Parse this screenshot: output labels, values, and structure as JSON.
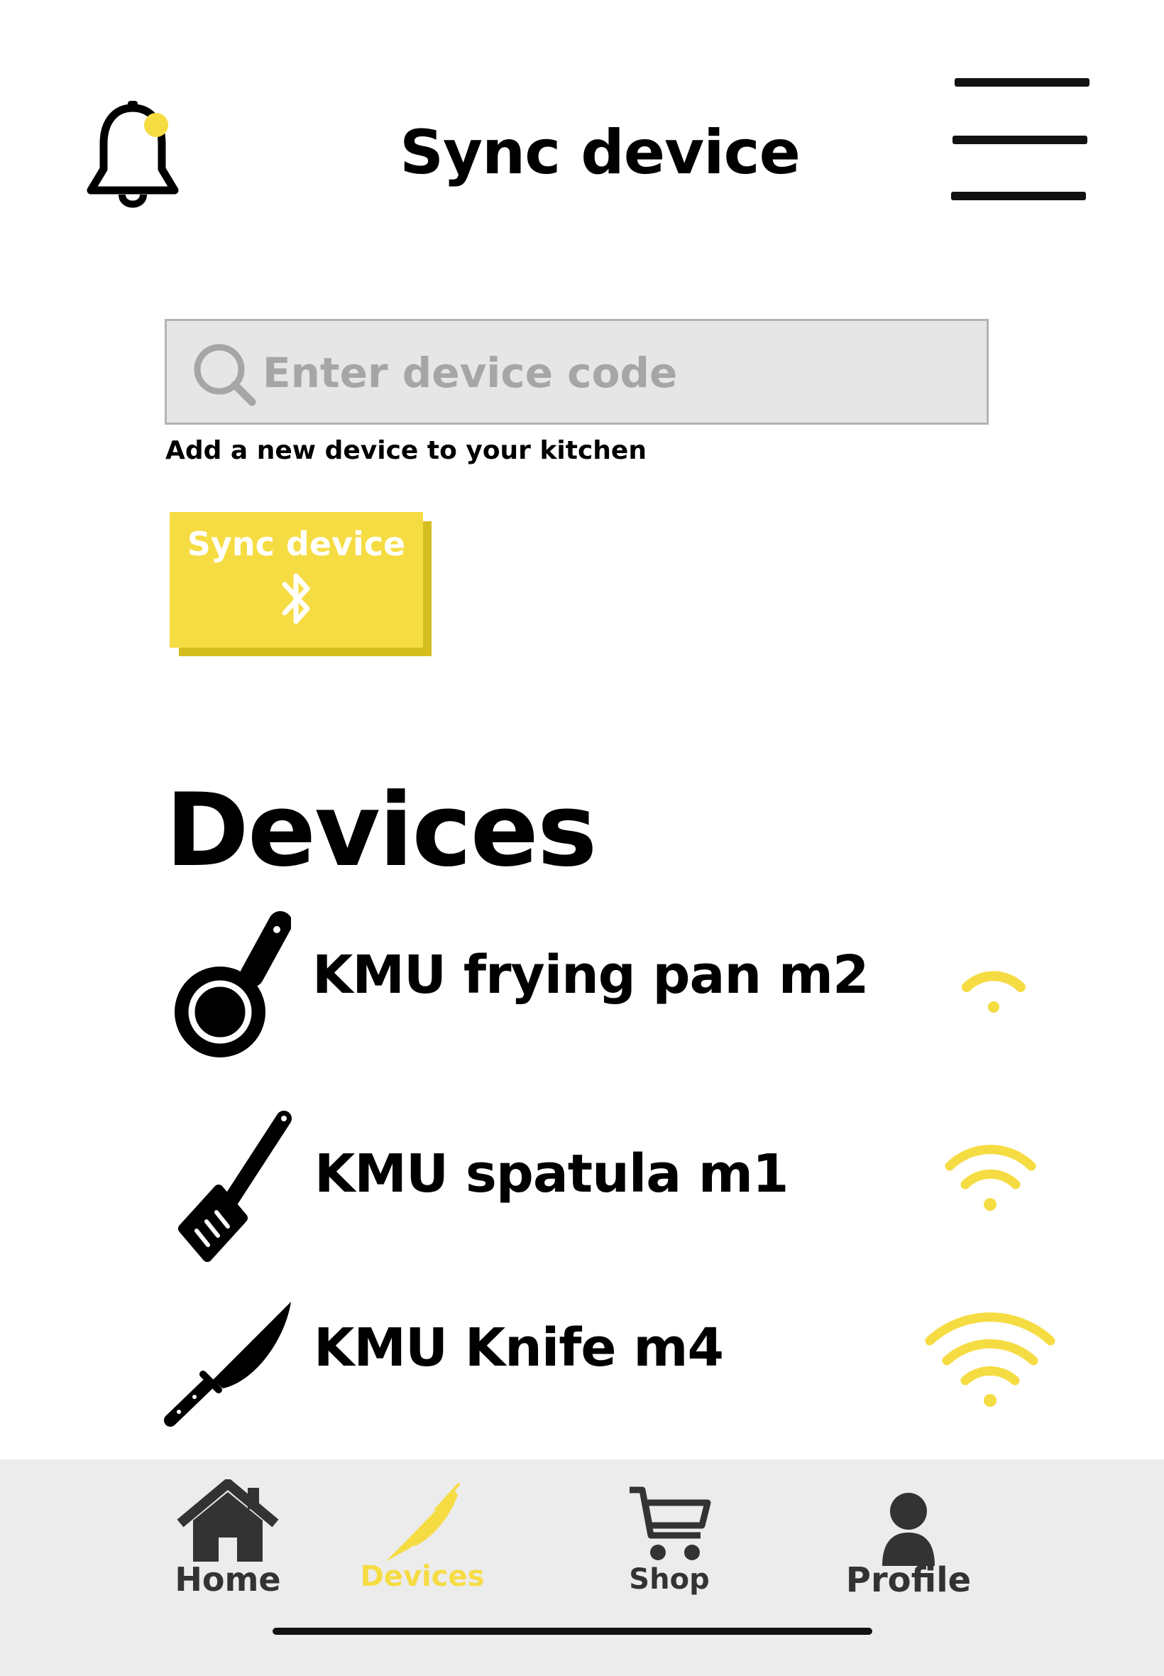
{
  "header": {
    "title": "Sync device",
    "notification_dot_color": "#f6dc43",
    "left_icon": "bell-icon",
    "right_icon": "hamburger-menu-icon"
  },
  "search": {
    "placeholder": "Enter device code",
    "value": "",
    "hint": "Add a new device to your kitchen"
  },
  "sync_button": {
    "label": "Sync device",
    "icon": "bluetooth-icon",
    "color": "#f6dc43"
  },
  "devices": {
    "heading": "Devices",
    "items": [
      {
        "name": "KMU frying pan m2",
        "icon": "frying-pan-icon",
        "signal": "weak"
      },
      {
        "name": "KMU spatula m1",
        "icon": "spatula-icon",
        "signal": "medium"
      },
      {
        "name": "KMU Knife m4",
        "icon": "knife-icon",
        "signal": "strong"
      }
    ]
  },
  "tabbar": {
    "active_color": "#f6dc43",
    "tabs": [
      {
        "label": "Home",
        "icon": "home-icon",
        "active": false
      },
      {
        "label": "Devices",
        "icon": "knife-icon",
        "active": true
      },
      {
        "label": "Shop",
        "icon": "cart-icon",
        "active": false
      },
      {
        "label": "Profile",
        "icon": "user-icon",
        "active": false
      }
    ]
  }
}
